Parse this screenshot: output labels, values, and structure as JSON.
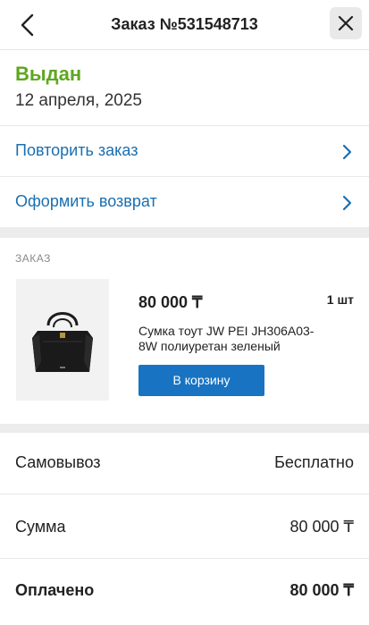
{
  "header": {
    "title": "Заказ №531548713",
    "back_icon": "chevron-left-icon",
    "close_icon": "close-icon"
  },
  "status": {
    "label": "Выдан",
    "date": "12 апреля, 2025",
    "color": "#5fa720"
  },
  "actions": [
    {
      "label": "Повторить заказ",
      "icon": "chevron-right-icon"
    },
    {
      "label": "Оформить возврат",
      "icon": "chevron-right-icon"
    }
  ],
  "order": {
    "section_label": "ЗАКАЗ",
    "item": {
      "price": "80 000 ₸",
      "quantity": "1 шт",
      "name": "Сумка тоут JW PEI JH306A03-8W полиуретан зеленый",
      "cart_button": "В корзину"
    }
  },
  "summary": [
    {
      "key": "Самовывоз",
      "value": "Бесплатно"
    },
    {
      "key": "Сумма",
      "value": "80 000 ₸"
    },
    {
      "key": "Оплачено",
      "value": "80 000 ₸"
    }
  ],
  "colors": {
    "accent": "#1873c2",
    "link": "#1a6fb0",
    "status_green": "#5fa720"
  }
}
